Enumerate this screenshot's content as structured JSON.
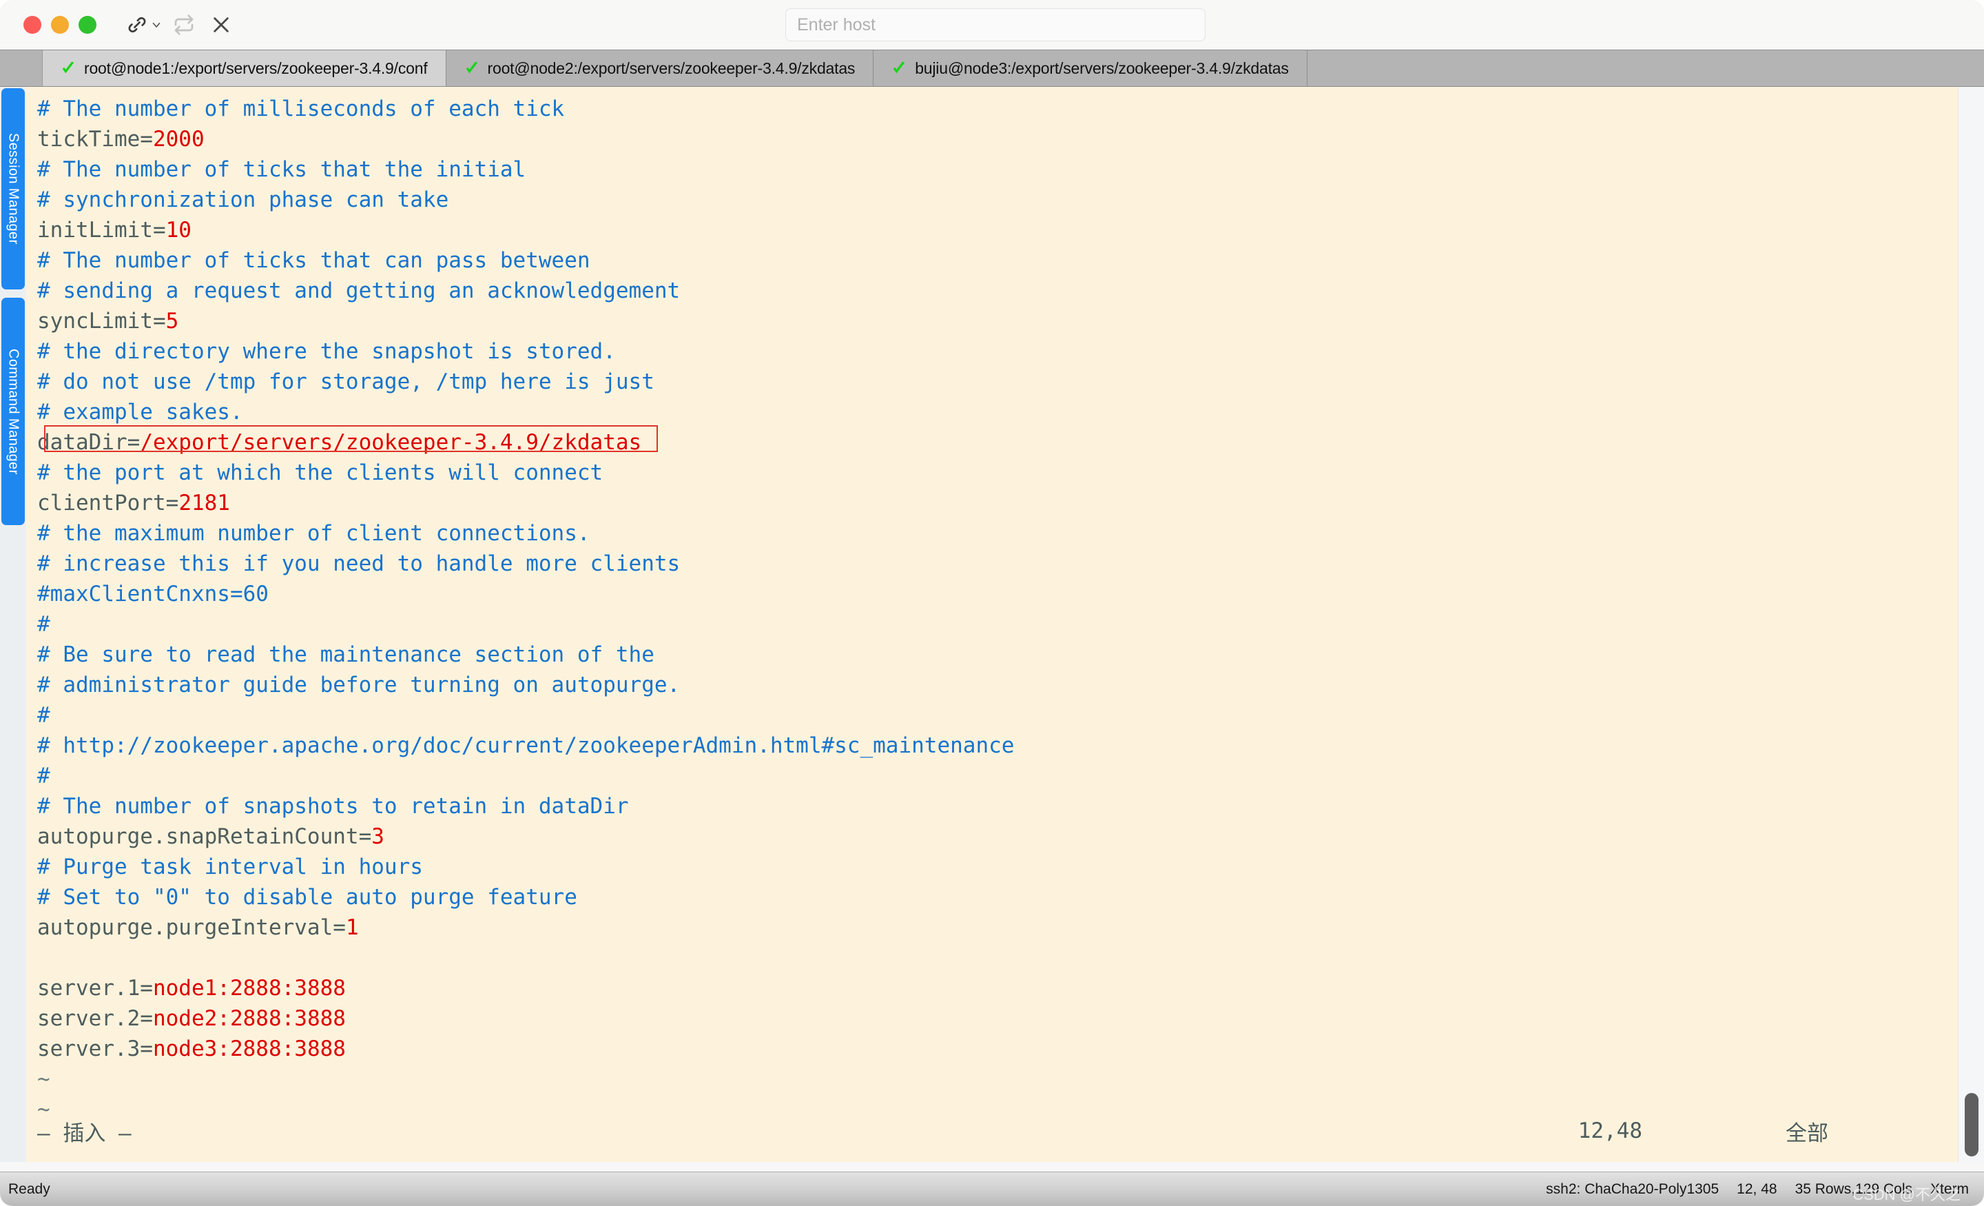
{
  "window": {
    "traffic_lights": [
      "close",
      "minimize",
      "zoom"
    ],
    "colors": {
      "terminal_bg": "#fdf3dc",
      "comment": "#1873cc",
      "key": "#4e5d5d",
      "value": "#dd0000",
      "accent_blue": "#1e88f0",
      "annotation_red": "#e0342b"
    }
  },
  "toolbar": {
    "connect_label": "connect",
    "dropdown_label": "connect-options",
    "reconnect_label": "reconnect",
    "disconnect_label": "disconnect"
  },
  "host": {
    "value": "",
    "placeholder": "Enter host"
  },
  "tabs": [
    {
      "label": "root@node1:/export/servers/zookeeper-3.4.9/conf",
      "status": "connected",
      "active": true
    },
    {
      "label": "root@node2:/export/servers/zookeeper-3.4.9/zkdatas",
      "status": "connected",
      "active": false
    },
    {
      "label": "bujiu@node3:/export/servers/zookeeper-3.4.9/zkdatas",
      "status": "connected",
      "active": false
    }
  ],
  "dock": {
    "session_manager": "Session Manager",
    "command_manager": "Command Manager"
  },
  "terminal": {
    "lines": [
      [
        {
          "t": "# The number of milliseconds of each tick",
          "c": "comment"
        }
      ],
      [
        {
          "t": "tickTime=",
          "c": "key"
        },
        {
          "t": "2000",
          "c": "val"
        }
      ],
      [
        {
          "t": "# The number of ticks that the initial",
          "c": "comment"
        }
      ],
      [
        {
          "t": "# synchronization phase can take",
          "c": "comment"
        }
      ],
      [
        {
          "t": "initLimit=",
          "c": "key"
        },
        {
          "t": "10",
          "c": "val"
        }
      ],
      [
        {
          "t": "# The number of ticks that can pass between",
          "c": "comment"
        }
      ],
      [
        {
          "t": "# sending a request and getting an acknowledgement",
          "c": "comment"
        }
      ],
      [
        {
          "t": "syncLimit=",
          "c": "key"
        },
        {
          "t": "5",
          "c": "val"
        }
      ],
      [
        {
          "t": "# the directory where the snapshot is stored.",
          "c": "comment"
        }
      ],
      [
        {
          "t": "# do not use /tmp for storage, /tmp here is just",
          "c": "comment"
        }
      ],
      [
        {
          "t": "# example sakes.",
          "c": "comment"
        }
      ],
      [
        {
          "t": "dataDir=",
          "c": "key"
        },
        {
          "t": "/export/servers/zookeeper-3.4.9/zkdatas",
          "c": "val"
        }
      ],
      [
        {
          "t": "# the port at which the clients will connect",
          "c": "comment"
        }
      ],
      [
        {
          "t": "clientPort=",
          "c": "key"
        },
        {
          "t": "2181",
          "c": "val"
        }
      ],
      [
        {
          "t": "# the maximum number of client connections.",
          "c": "comment"
        }
      ],
      [
        {
          "t": "# increase this if you need to handle more clients",
          "c": "comment"
        }
      ],
      [
        {
          "t": "#maxClientCnxns=60",
          "c": "comment"
        }
      ],
      [
        {
          "t": "#",
          "c": "comment"
        }
      ],
      [
        {
          "t": "# Be sure to read the maintenance section of the",
          "c": "comment"
        }
      ],
      [
        {
          "t": "# administrator guide before turning on autopurge.",
          "c": "comment"
        }
      ],
      [
        {
          "t": "#",
          "c": "comment"
        }
      ],
      [
        {
          "t": "# http://zookeeper.apache.org/doc/current/zookeeperAdmin.html#sc_maintenance",
          "c": "comment"
        }
      ],
      [
        {
          "t": "#",
          "c": "comment"
        }
      ],
      [
        {
          "t": "# The number of snapshots to retain in dataDir",
          "c": "comment"
        }
      ],
      [
        {
          "t": "autopurge.snapRetainCount=",
          "c": "key"
        },
        {
          "t": "3",
          "c": "val"
        }
      ],
      [
        {
          "t": "# Purge task interval in hours",
          "c": "comment"
        }
      ],
      [
        {
          "t": "# Set to \"0\" to disable auto purge feature",
          "c": "comment"
        }
      ],
      [
        {
          "t": "autopurge.purgeInterval=",
          "c": "key"
        },
        {
          "t": "1",
          "c": "val"
        }
      ],
      [
        {
          "t": "",
          "c": "key"
        }
      ],
      [
        {
          "t": "server.1=",
          "c": "key"
        },
        {
          "t": "node1:2888:3888",
          "c": "val"
        }
      ],
      [
        {
          "t": "server.2=",
          "c": "key"
        },
        {
          "t": "node2:2888:3888",
          "c": "val"
        }
      ],
      [
        {
          "t": "server.3=",
          "c": "key"
        },
        {
          "t": "node3:2888:3888",
          "c": "val"
        }
      ],
      [
        {
          "t": "~",
          "c": "tilde"
        }
      ],
      [
        {
          "t": "~",
          "c": "tilde"
        }
      ]
    ],
    "annotation": {
      "target_line": "dataDir=/export/servers/zookeeper-3.4.9/zkdatas"
    },
    "vim": {
      "mode": "— 插入 —",
      "position": "12,48",
      "percent": "全部"
    }
  },
  "statusbar": {
    "ready": "Ready",
    "cipher": "ssh2: ChaCha20-Poly1305",
    "cursor": "12, 48",
    "geometry": "35 Rows,129 Cols",
    "emulation": "Xterm",
    "watermark": "CSDN @不久之"
  }
}
